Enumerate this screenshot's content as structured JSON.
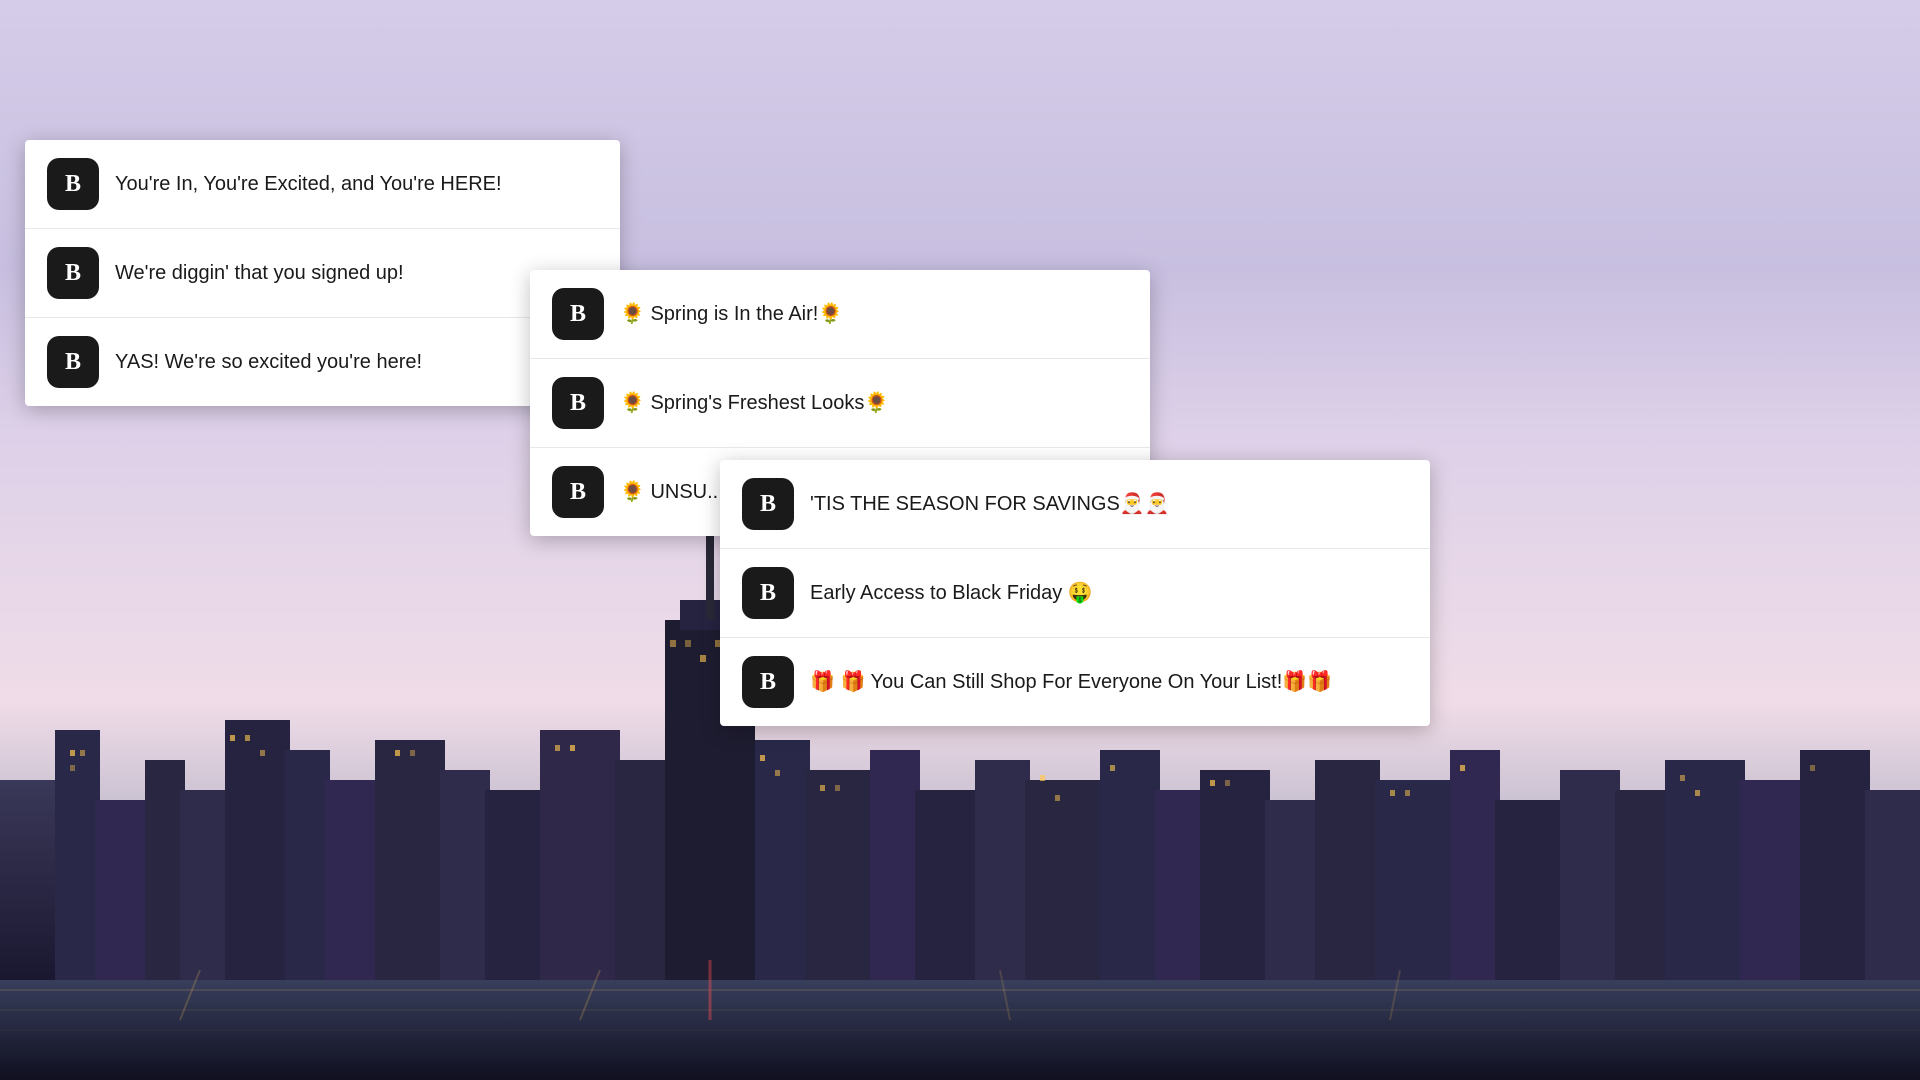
{
  "background": {
    "alt": "Chicago city skyline at dusk with purple sky and city lights reflecting on water"
  },
  "cards": [
    {
      "id": "card-1",
      "rows": [
        {
          "icon": "B",
          "text": "You're In, You're Excited, and You're HERE!"
        },
        {
          "icon": "B",
          "text": "We're diggin' that you signed up!"
        },
        {
          "icon": "B",
          "text": "YAS! We're so excited you're here!"
        }
      ]
    },
    {
      "id": "card-2",
      "rows": [
        {
          "icon": "B",
          "text": "🌻 Spring is In the Air!🌻"
        },
        {
          "icon": "B",
          "text": "🌻 Spring's Freshest Looks🌻"
        },
        {
          "icon": "B",
          "text": "🌻 UNSU..."
        }
      ]
    },
    {
      "id": "card-3",
      "rows": [
        {
          "icon": "B",
          "text": "'TIS THE SEASON FOR SAVINGS🎅🎅"
        },
        {
          "icon": "B",
          "text": "Early Access to Black Friday 🤑"
        },
        {
          "icon": "B",
          "text": "🎁 🎁 You Can Still Shop For Everyone On Your List!🎁🎁"
        }
      ]
    }
  ]
}
